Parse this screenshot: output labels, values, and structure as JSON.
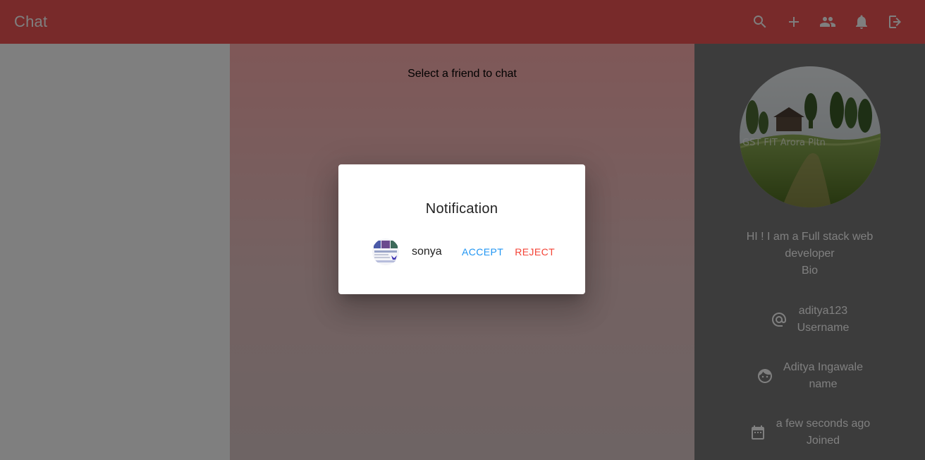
{
  "appbar": {
    "title": "Chat",
    "actions": [
      {
        "icon": "search-icon"
      },
      {
        "icon": "add-icon"
      },
      {
        "icon": "people-icon"
      },
      {
        "icon": "bell-icon"
      },
      {
        "icon": "logout-icon"
      }
    ],
    "color": "#f05454"
  },
  "chat": {
    "empty_text": "Select a friend to chat"
  },
  "profile": {
    "bio": "HI ! I am a Full stack web developer",
    "bio_label": "Bio",
    "username": "aditya123",
    "username_label": "Username",
    "name": "Aditya Ingawale",
    "name_label": "name",
    "joined": "a few seconds ago",
    "joined_label": "Joined"
  },
  "dialog": {
    "title": "Notification",
    "request": {
      "name": "sonya",
      "accept_label": "ACCEPT",
      "reject_label": "REJECT"
    },
    "accept_color": "#2196f3",
    "reject_color": "#f44336"
  }
}
